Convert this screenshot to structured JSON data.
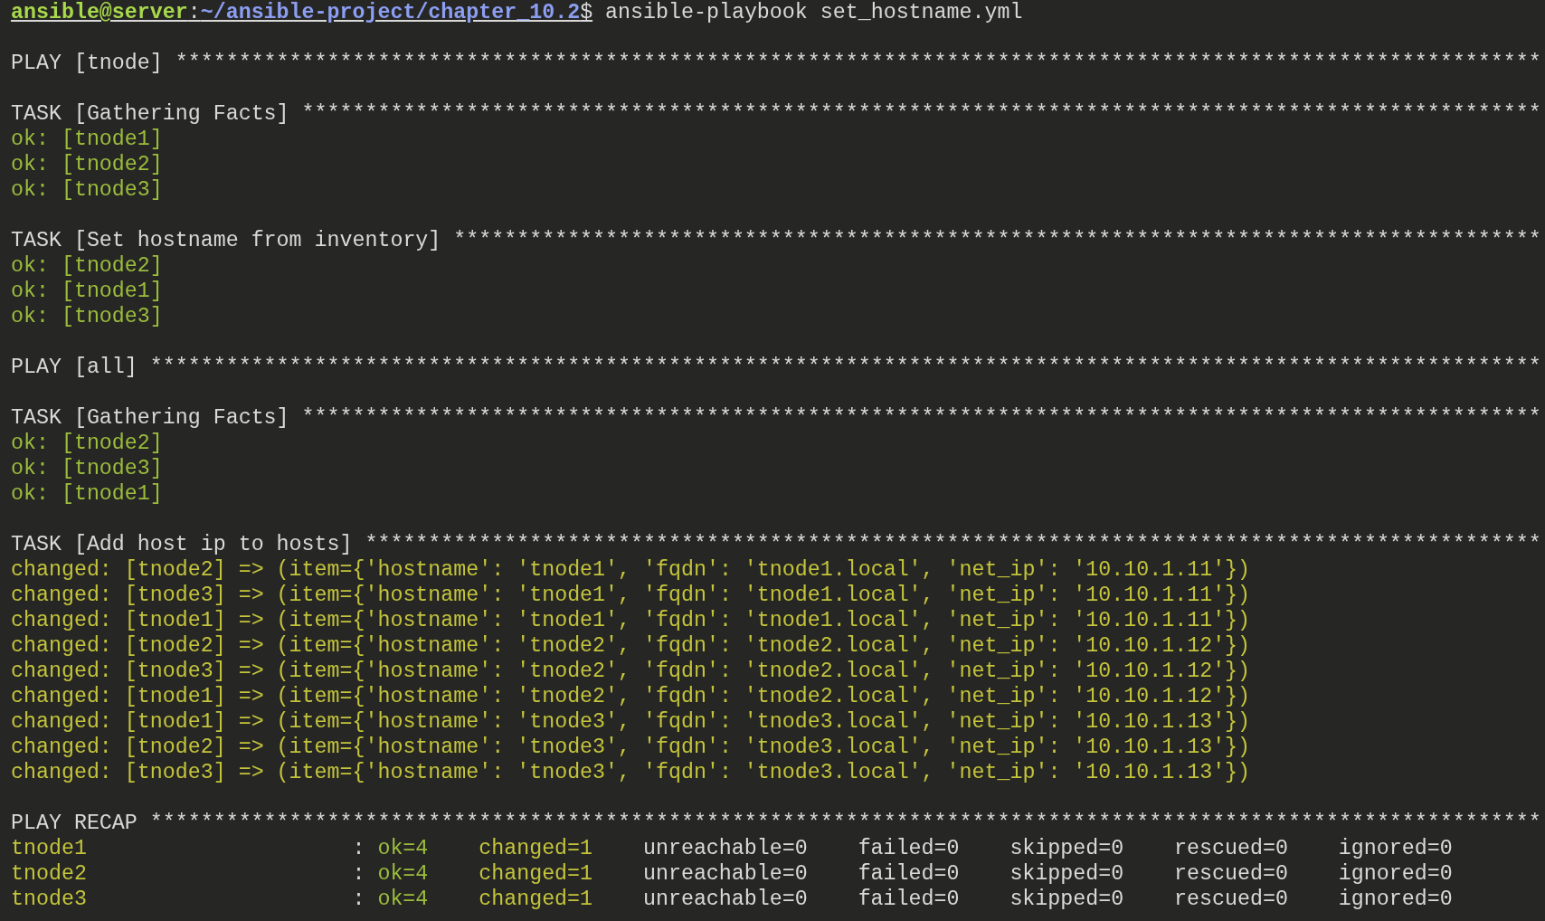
{
  "prompt": {
    "user_host": "ansible@server",
    "separator": ":",
    "path": "~/ansible-project/chapter_10.2",
    "symbol": "$",
    "command": "ansible-playbook set_hostname.yml"
  },
  "sections": [
    {
      "title": "PLAY [tnode]",
      "stars": "************************************************************************************************************"
    },
    {
      "title": "TASK [Gathering Facts]",
      "stars": "**************************************************************************************************",
      "lines": [
        {
          "kind": "ok",
          "text": "ok: [tnode1]"
        },
        {
          "kind": "ok",
          "text": "ok: [tnode2]"
        },
        {
          "kind": "ok",
          "text": "ok: [tnode3]"
        }
      ]
    },
    {
      "title": "TASK [Set hostname from inventory]",
      "stars": "**************************************************************************************",
      "lines": [
        {
          "kind": "ok",
          "text": "ok: [tnode2]"
        },
        {
          "kind": "ok",
          "text": "ok: [tnode1]"
        },
        {
          "kind": "ok",
          "text": "ok: [tnode3]"
        }
      ]
    },
    {
      "title": "PLAY [all]",
      "stars": "**************************************************************************************************************"
    },
    {
      "title": "TASK [Gathering Facts]",
      "stars": "**************************************************************************************************",
      "lines": [
        {
          "kind": "ok",
          "text": "ok: [tnode2]"
        },
        {
          "kind": "ok",
          "text": "ok: [tnode3]"
        },
        {
          "kind": "ok",
          "text": "ok: [tnode1]"
        }
      ]
    },
    {
      "title": "TASK [Add host ip to hosts]",
      "stars": "*********************************************************************************************",
      "lines": [
        {
          "kind": "changed",
          "text": "changed: [tnode2] => (item={'hostname': 'tnode1', 'fqdn': 'tnode1.local', 'net_ip': '10.10.1.11'})"
        },
        {
          "kind": "changed",
          "text": "changed: [tnode3] => (item={'hostname': 'tnode1', 'fqdn': 'tnode1.local', 'net_ip': '10.10.1.11'})"
        },
        {
          "kind": "changed",
          "text": "changed: [tnode1] => (item={'hostname': 'tnode1', 'fqdn': 'tnode1.local', 'net_ip': '10.10.1.11'})"
        },
        {
          "kind": "changed",
          "text": "changed: [tnode2] => (item={'hostname': 'tnode2', 'fqdn': 'tnode2.local', 'net_ip': '10.10.1.12'})"
        },
        {
          "kind": "changed",
          "text": "changed: [tnode3] => (item={'hostname': 'tnode2', 'fqdn': 'tnode2.local', 'net_ip': '10.10.1.12'})"
        },
        {
          "kind": "changed",
          "text": "changed: [tnode1] => (item={'hostname': 'tnode2', 'fqdn': 'tnode2.local', 'net_ip': '10.10.1.12'})"
        },
        {
          "kind": "changed",
          "text": "changed: [tnode1] => (item={'hostname': 'tnode3', 'fqdn': 'tnode3.local', 'net_ip': '10.10.1.13'})"
        },
        {
          "kind": "changed",
          "text": "changed: [tnode2] => (item={'hostname': 'tnode3', 'fqdn': 'tnode3.local', 'net_ip': '10.10.1.13'})"
        },
        {
          "kind": "changed",
          "text": "changed: [tnode3] => (item={'hostname': 'tnode3', 'fqdn': 'tnode3.local', 'net_ip': '10.10.1.13'})"
        }
      ]
    },
    {
      "title": "PLAY RECAP",
      "stars": "**************************************************************************************************************"
    }
  ],
  "recap": [
    {
      "host": "tnode1",
      "colon": ":",
      "stats": [
        "ok=4",
        "changed=1",
        "unreachable=0",
        "failed=0",
        "skipped=0",
        "rescued=0",
        "ignored=0"
      ]
    },
    {
      "host": "tnode2",
      "colon": ":",
      "stats": [
        "ok=4",
        "changed=1",
        "unreachable=0",
        "failed=0",
        "skipped=0",
        "rescued=0",
        "ignored=0"
      ]
    },
    {
      "host": "tnode3",
      "colon": ":",
      "stats": [
        "ok=4",
        "changed=1",
        "unreachable=0",
        "failed=0",
        "skipped=0",
        "rescued=0",
        "ignored=0"
      ]
    }
  ]
}
